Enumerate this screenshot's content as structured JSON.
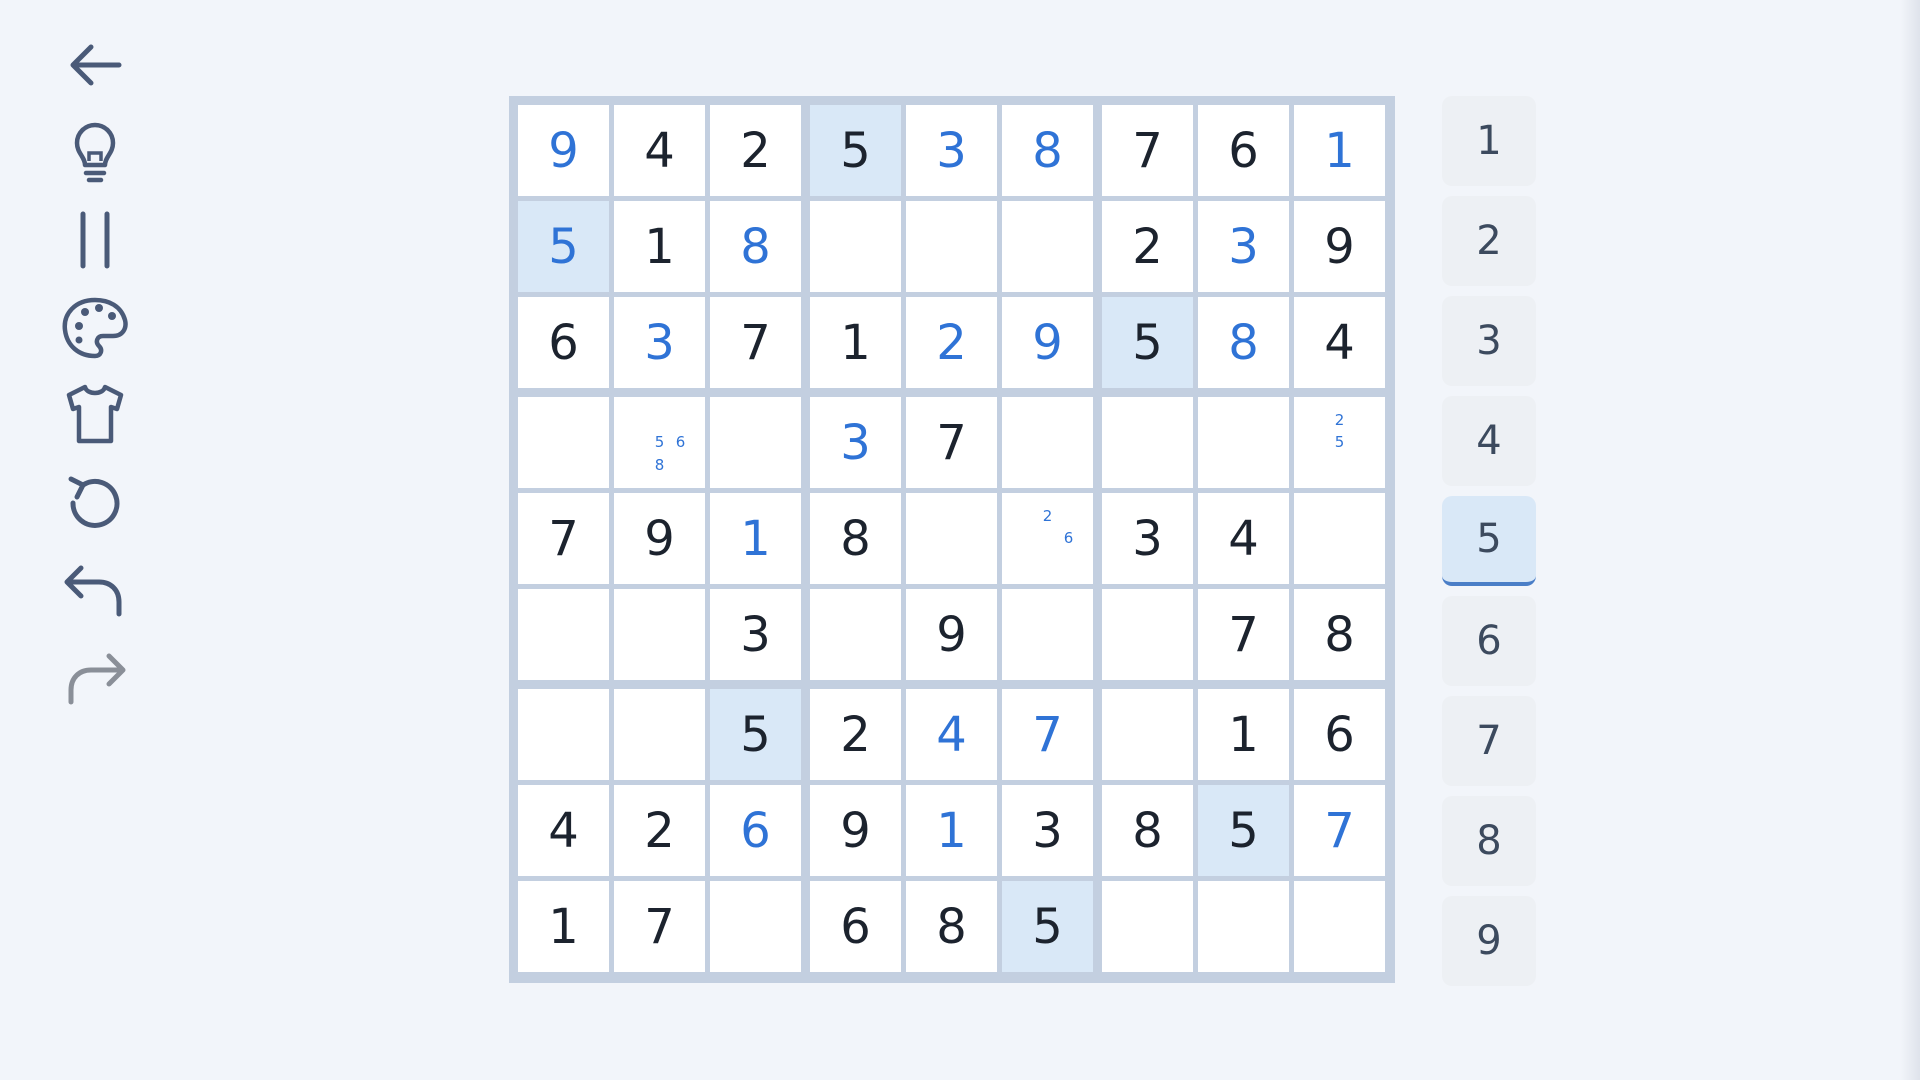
{
  "toolbar": [
    {
      "icon": "back-arrow-icon",
      "enabled": true
    },
    {
      "icon": "lightbulb-icon",
      "enabled": true
    },
    {
      "icon": "pause-icon",
      "enabled": true
    },
    {
      "icon": "palette-icon",
      "enabled": true
    },
    {
      "icon": "tshirt-icon",
      "enabled": true
    },
    {
      "icon": "restart-icon",
      "enabled": true
    },
    {
      "icon": "undo-icon",
      "enabled": true
    },
    {
      "icon": "redo-icon",
      "enabled": false
    }
  ],
  "board": {
    "values": [
      [
        "9",
        "4",
        "2",
        "5",
        "3",
        "8",
        "7",
        "6",
        "1"
      ],
      [
        "5",
        "1",
        "8",
        "",
        "",
        "",
        "2",
        "3",
        "9"
      ],
      [
        "6",
        "3",
        "7",
        "1",
        "2",
        "9",
        "5",
        "8",
        "4"
      ],
      [
        "",
        "",
        "",
        "3",
        "7",
        "",
        "",
        "",
        ""
      ],
      [
        "7",
        "9",
        "1",
        "8",
        "",
        "",
        "3",
        "4",
        ""
      ],
      [
        "",
        "",
        "3",
        "",
        "9",
        "",
        "",
        "7",
        "8"
      ],
      [
        "",
        "",
        "5",
        "2",
        "4",
        "7",
        "",
        "1",
        "6"
      ],
      [
        "4",
        "2",
        "6",
        "9",
        "1",
        "3",
        "8",
        "5",
        "7"
      ],
      [
        "1",
        "7",
        "",
        "6",
        "8",
        "5",
        "",
        "",
        ""
      ]
    ],
    "user_entered": [
      [
        1,
        0,
        0,
        0,
        1,
        1,
        0,
        0,
        1
      ],
      [
        1,
        0,
        1,
        0,
        0,
        0,
        0,
        1,
        0
      ],
      [
        0,
        1,
        0,
        0,
        1,
        1,
        0,
        1,
        0
      ],
      [
        0,
        0,
        0,
        1,
        0,
        0,
        0,
        0,
        0
      ],
      [
        0,
        0,
        1,
        0,
        0,
        0,
        0,
        0,
        0
      ],
      [
        0,
        0,
        0,
        0,
        0,
        0,
        0,
        0,
        0
      ],
      [
        0,
        0,
        0,
        0,
        1,
        1,
        0,
        0,
        0
      ],
      [
        0,
        0,
        1,
        0,
        1,
        0,
        0,
        0,
        1
      ],
      [
        0,
        0,
        0,
        0,
        0,
        0,
        0,
        0,
        0
      ]
    ],
    "highlighted_digit": "5",
    "notes": [
      {
        "row": 3,
        "col": 1,
        "digits": [
          "5",
          "6",
          "8"
        ]
      },
      {
        "row": 3,
        "col": 8,
        "digits": [
          "2",
          "5"
        ]
      },
      {
        "row": 4,
        "col": 5,
        "digits": [
          "2",
          "6"
        ]
      }
    ]
  },
  "numpad": {
    "digits": [
      "1",
      "2",
      "3",
      "4",
      "5",
      "6",
      "7",
      "8",
      "9"
    ],
    "selected": "5"
  },
  "colors": {
    "given": "#1c232e",
    "user": "#2f73d6",
    "highlight": "#d9e8f7",
    "grid": "#c3cfe0",
    "icon": "#4a5a78",
    "icon_disabled": "#8a8f98"
  }
}
